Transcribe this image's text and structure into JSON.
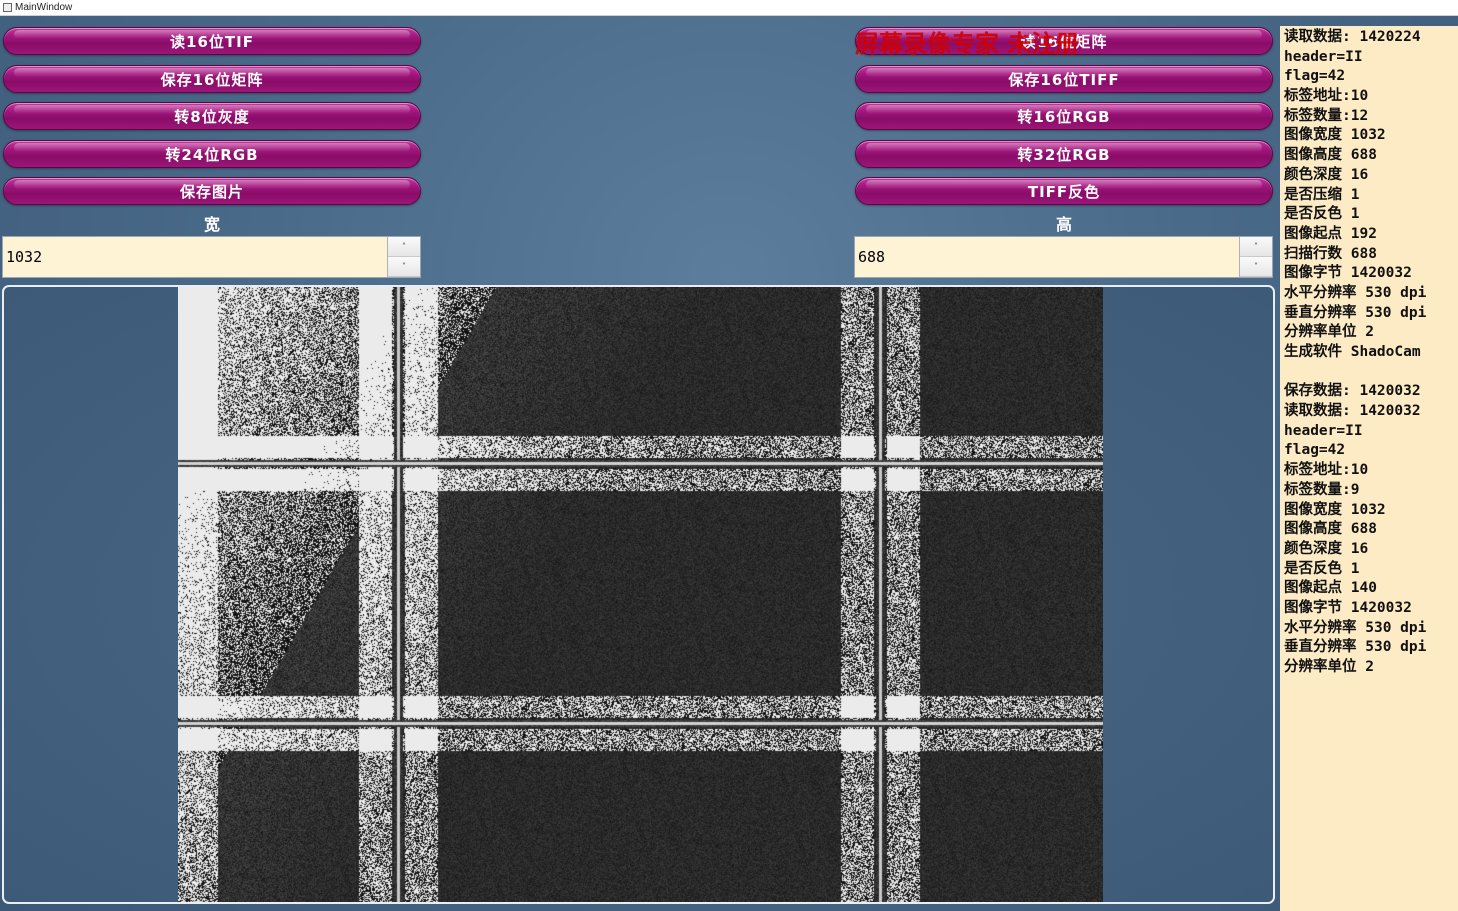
{
  "window": {
    "title": "MainWindow"
  },
  "watermark": "屏幕录像专家 未注册",
  "buttons_left": [
    {
      "label": "读16位TIF"
    },
    {
      "label": "保存16位矩阵"
    },
    {
      "label": "转8位灰度"
    },
    {
      "label": "转24位RGB"
    },
    {
      "label": "保存图片"
    }
  ],
  "buttons_right": [
    {
      "label": "读16位矩阵"
    },
    {
      "label": "保存16位TIFF"
    },
    {
      "label": "转16位RGB"
    },
    {
      "label": "转32位RGB"
    },
    {
      "label": "TIFF反色"
    }
  ],
  "width_field": {
    "label": "宽",
    "value": "1032",
    "up_icon": "˄",
    "down_icon": "˅"
  },
  "height_field": {
    "label": "高",
    "value": "688",
    "up_icon": "˄",
    "down_icon": "˅"
  },
  "log_lines": [
    "读取数据: 1420224",
    "header=II",
    "flag=42",
    "标签地址:10",
    "标签数量:12",
    "图像宽度 1032",
    "图像高度 688",
    "颜色深度 16",
    "是否压缩 1",
    "是否反色 1",
    "图像起点 192",
    "扫描行数 688",
    "图像字节 1420032",
    "水平分辨率 530 dpi",
    "垂直分辨率 530 dpi",
    "分辨率单位 2",
    "生成软件 ShadoCam",
    "",
    "保存数据: 1420032",
    "读取数据: 1420032",
    "header=II",
    "flag=42",
    "标签地址:10",
    "标签数量:9",
    "图像宽度 1032",
    "图像高度 688",
    "颜色深度 16",
    "是否反色 1",
    "图像起点 140",
    "图像字节 1420032",
    "水平分辨率 530 dpi",
    "垂直分辨率 530 dpi",
    "分辨率单位 2"
  ]
}
